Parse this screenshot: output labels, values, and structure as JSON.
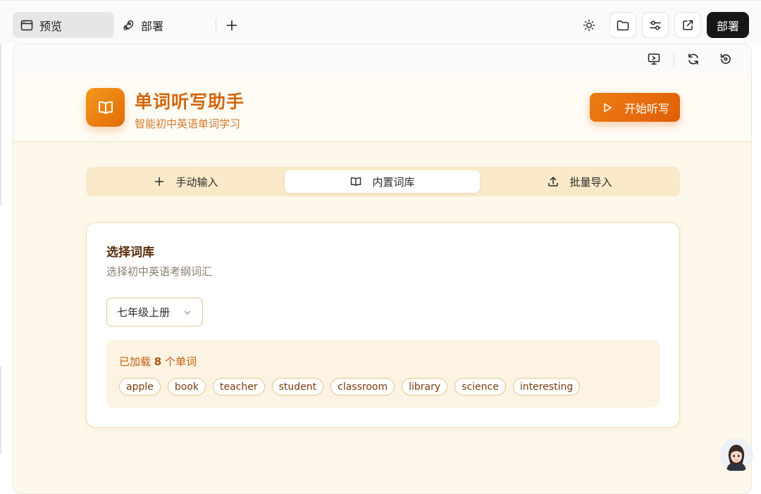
{
  "topbar": {
    "tabs": [
      {
        "label": "预览",
        "icon": "window-icon"
      },
      {
        "label": "部署",
        "icon": "rocket-icon"
      }
    ],
    "add_tab_icon": "plus-icon",
    "actions": [
      "sun-icon",
      "folder-icon",
      "sliders-icon",
      "external-link-icon"
    ],
    "deploy_label": "部署"
  },
  "frame_toolbar": {
    "actions": [
      "monitor-icon",
      "refresh-icon",
      "history-icon"
    ]
  },
  "app": {
    "title": "单词听写助手",
    "subtitle": "智能初中英语单词学习",
    "logo_icon": "book-open-icon",
    "start_label": "开始听写",
    "accent_color": "#e26b08",
    "background_color": "#fef8ea"
  },
  "segments": [
    {
      "label": "手动输入",
      "icon": "plus-icon",
      "active": false
    },
    {
      "label": "内置词库",
      "icon": "book-open-icon",
      "active": true
    },
    {
      "label": "批量导入",
      "icon": "upload-icon",
      "active": false
    }
  ],
  "card": {
    "title": "选择词库",
    "description": "选择初中英语考纲词汇",
    "select_value": "七年级上册",
    "loaded_prefix": "已加载",
    "loaded_count": "8",
    "loaded_suffix": "个单词",
    "words": [
      "apple",
      "book",
      "teacher",
      "student",
      "classroom",
      "library",
      "science",
      "interesting"
    ]
  }
}
